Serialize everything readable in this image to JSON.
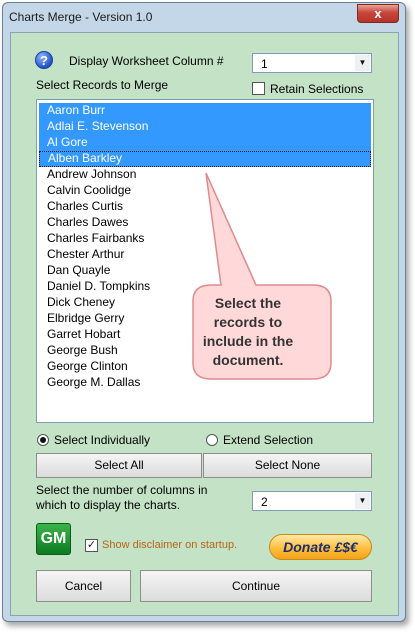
{
  "window": {
    "title": "Charts Merge - Version 1.0",
    "close_glyph": "x"
  },
  "header": {
    "help_icon": "question-mark-icon",
    "help_glyph": "?",
    "display_column_label": "Display Worksheet Column #",
    "display_column_value": "1",
    "select_records_label": "Select Records to Merge",
    "retain_selections_label": "Retain Selections",
    "retain_selections_checked": false
  },
  "records": {
    "items": [
      "Aaron Burr",
      "Adlai E. Stevenson",
      "Al Gore",
      "Alben Barkley",
      "Andrew Johnson",
      "Calvin Coolidge",
      "Charles Curtis",
      "Charles Dawes",
      "Charles Fairbanks",
      "Chester Arthur",
      "Dan Quayle",
      "Daniel D. Tompkins",
      "Dick Cheney",
      "Elbridge Gerry",
      "Garret Hobart",
      "George Bush",
      "George Clinton",
      "George M. Dallas"
    ],
    "selected": [
      0,
      1,
      2,
      3
    ],
    "focused": 3
  },
  "callout": {
    "text": "Select the records to include in the document.",
    "fill": "#ffd9da",
    "stroke": "#e08a8d"
  },
  "selection_mode": {
    "individually_label": "Select Individually",
    "extend_label": "Extend Selection",
    "selected": "individually"
  },
  "buttons": {
    "select_all": "Select All",
    "select_none": "Select None",
    "cancel": "Cancel",
    "continue": "Continue"
  },
  "columns": {
    "label_line1": "Select the number of columns in",
    "label_line2": "which to display the charts.",
    "value": "2"
  },
  "footer": {
    "logo_text": "GM",
    "disclaimer_label": "Show disclaimer on startup.",
    "disclaimer_checked": true,
    "donate_label": "Donate £$€"
  },
  "colors": {
    "client_bg": "#c4e2c6",
    "selection": "#3399ff",
    "disclaimer_text": "#b5651d"
  }
}
